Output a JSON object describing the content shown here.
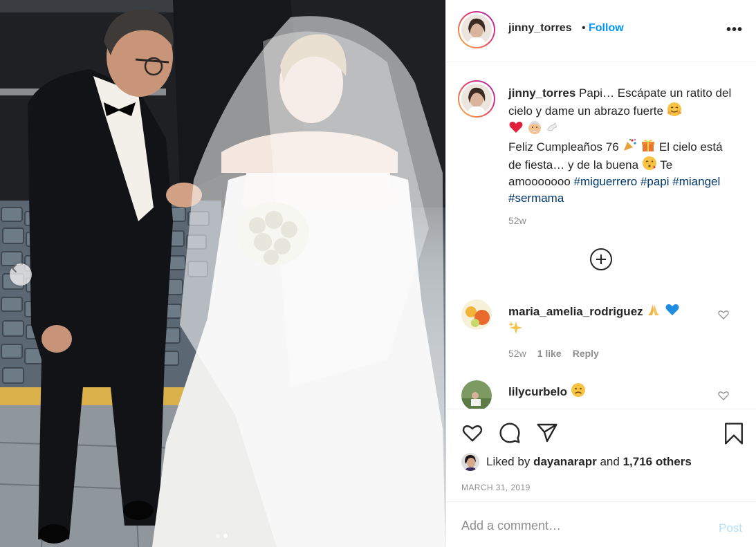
{
  "post": {
    "author": "jinny_torres",
    "follow_label": "Follow",
    "separator": "•",
    "more_label": "•••"
  },
  "caption": {
    "line1": "Papi… Escápate un ratito del cielo y dame un abrazo fuerte",
    "line2": "Feliz Cumpleaños 76",
    "line3": "El cielo está de fiesta… y de la buena",
    "line4": "Te amooooooo",
    "hashtags": [
      "#miguerrero",
      "#papi",
      "#miangel",
      "#sermama"
    ],
    "time": "52w"
  },
  "comments": [
    {
      "user": "maria_amelia_rodriguez",
      "time": "52w",
      "likes": "1 like",
      "reply_label": "Reply"
    },
    {
      "user": "lilycurbelo"
    }
  ],
  "likes": {
    "prefix": "Liked by",
    "user": "dayanarapr",
    "middle": "and",
    "count": "1,716 others"
  },
  "date": "MARCH 31, 2019",
  "add_comment": {
    "placeholder": "Add a comment…",
    "post_label": "Post"
  },
  "colors": {
    "accent": "#0095f6",
    "post_disabled": "#b2dffc",
    "hashtag": "#00376b",
    "muted": "#8e8e8e"
  },
  "icons": {
    "like": "heart-icon",
    "comment": "comment-icon",
    "share": "send-icon",
    "save": "bookmark-icon",
    "more": "more-icon",
    "load_more": "plus-circle-icon",
    "carousel_prev": "chevron-left-icon"
  },
  "carousel": {
    "count": 2,
    "active": 2
  }
}
